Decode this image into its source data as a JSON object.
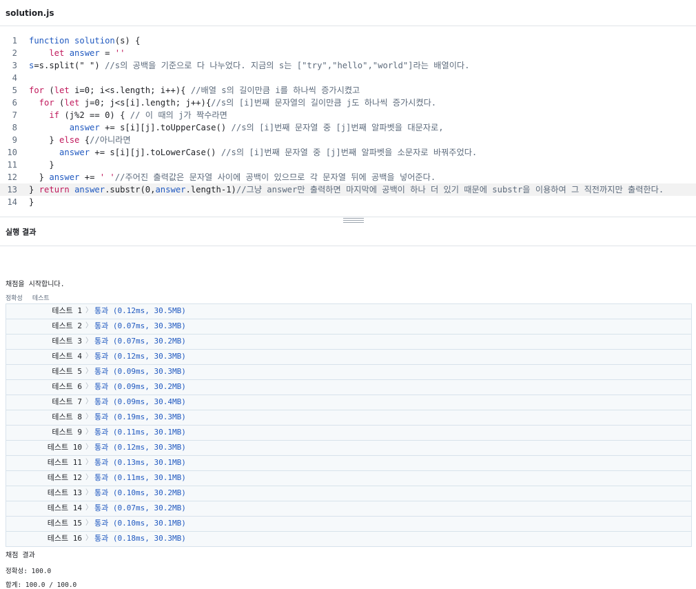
{
  "file": {
    "name": "solution.js"
  },
  "editor": {
    "lines": [
      {
        "num": "1",
        "tokens": [
          {
            "t": "function ",
            "c": "fn"
          },
          {
            "t": "solution",
            "c": "fn"
          },
          {
            "t": "(s) {",
            "c": ""
          }
        ]
      },
      {
        "num": "2",
        "tokens": [
          {
            "t": "    let ",
            "c": "kw"
          },
          {
            "t": "answer",
            "c": "fn"
          },
          {
            "t": " = ",
            "c": ""
          },
          {
            "t": "''",
            "c": "str"
          }
        ]
      },
      {
        "num": "3",
        "tokens": [
          {
            "t": "s",
            "c": "fn"
          },
          {
            "t": "=s.split(\" \") ",
            "c": ""
          },
          {
            "t": "//s의 공백을 기준으로 다 나누었다. 지금의 s는 [\"try\",\"hello\",\"world\"]라는 배열이다.",
            "c": "cm"
          }
        ]
      },
      {
        "num": "4",
        "tokens": []
      },
      {
        "num": "5",
        "tokens": [
          {
            "t": "for ",
            "c": "kw"
          },
          {
            "t": "(",
            "c": ""
          },
          {
            "t": "let ",
            "c": "kw"
          },
          {
            "t": "i=0; i<s.length; i++){ ",
            "c": ""
          },
          {
            "t": "//배열 s의 길이만큼 i를 하나씩 증가시켰고",
            "c": "cm"
          }
        ]
      },
      {
        "num": "6",
        "tokens": [
          {
            "t": "  for ",
            "c": "kw"
          },
          {
            "t": "(",
            "c": ""
          },
          {
            "t": "let ",
            "c": "kw"
          },
          {
            "t": "j=0; j<s[i].length; j++){",
            "c": ""
          },
          {
            "t": "//s의 [i]번째 문자열의 길이만큼 j도 하나씩 증가시켰다.",
            "c": "cm"
          }
        ]
      },
      {
        "num": "7",
        "tokens": [
          {
            "t": "    if ",
            "c": "kw"
          },
          {
            "t": "(j%2 == 0) { ",
            "c": ""
          },
          {
            "t": "// 이 때의 j가 짝수라면",
            "c": "cm"
          }
        ]
      },
      {
        "num": "8",
        "tokens": [
          {
            "t": "        ",
            "c": ""
          },
          {
            "t": "answer",
            "c": "fn"
          },
          {
            "t": " += s[i][j].toUpperCase() ",
            "c": ""
          },
          {
            "t": "//s의 [i]번째 문자열 중 [j]번째 알파벳을 대문자로,",
            "c": "cm"
          }
        ]
      },
      {
        "num": "9",
        "tokens": [
          {
            "t": "    } ",
            "c": ""
          },
          {
            "t": "else ",
            "c": "kw"
          },
          {
            "t": "{",
            "c": ""
          },
          {
            "t": "//아니라면",
            "c": "cm"
          }
        ]
      },
      {
        "num": "10",
        "tokens": [
          {
            "t": "      ",
            "c": ""
          },
          {
            "t": "answer",
            "c": "fn"
          },
          {
            "t": " += s[i][j].toLowerCase() ",
            "c": ""
          },
          {
            "t": "//s의 [i]번째 문자열 중 [j]번째 알파벳을 소문자로 바꿔주었다.",
            "c": "cm"
          }
        ]
      },
      {
        "num": "11",
        "tokens": [
          {
            "t": "    }",
            "c": ""
          }
        ]
      },
      {
        "num": "12",
        "tokens": [
          {
            "t": "  } ",
            "c": ""
          },
          {
            "t": "answer",
            "c": "fn"
          },
          {
            "t": " += ",
            "c": ""
          },
          {
            "t": "' '",
            "c": "str"
          },
          {
            "t": "//주어진 출력값은 문자열 사이에 공백이 있으므로 각 문자열 뒤에 공백을 넣어준다.",
            "c": "cm"
          }
        ]
      },
      {
        "num": "13",
        "tokens": [
          {
            "t": "} ",
            "c": ""
          },
          {
            "t": "return ",
            "c": "kw"
          },
          {
            "t": "answer",
            "c": "fn"
          },
          {
            "t": ".substr(0,",
            "c": ""
          },
          {
            "t": "answer",
            "c": "fn"
          },
          {
            "t": ".length-1)",
            "c": ""
          },
          {
            "t": "//그냥 answer만 출력하면 마지막에 공백이 하나 더 있기 때문에 substr을 이용하여 그 직전까지만 출력한다.",
            "c": "cm"
          }
        ]
      },
      {
        "num": "14",
        "tokens": [
          {
            "t": "}",
            "c": ""
          }
        ]
      }
    ],
    "active_line": 13
  },
  "result": {
    "title": "실행 결과",
    "start_message": "채점을 시작합니다.",
    "tabs": [
      "정확성",
      "테스트"
    ],
    "tests": [
      {
        "label": "테스트 1",
        "result": "통과 (0.12ms, 30.5MB)"
      },
      {
        "label": "테스트 2",
        "result": "통과 (0.07ms, 30.3MB)"
      },
      {
        "label": "테스트 3",
        "result": "통과 (0.07ms, 30.2MB)"
      },
      {
        "label": "테스트 4",
        "result": "통과 (0.12ms, 30.3MB)"
      },
      {
        "label": "테스트 5",
        "result": "통과 (0.09ms, 30.3MB)"
      },
      {
        "label": "테스트 6",
        "result": "통과 (0.09ms, 30.2MB)"
      },
      {
        "label": "테스트 7",
        "result": "통과 (0.09ms, 30.4MB)"
      },
      {
        "label": "테스트 8",
        "result": "통과 (0.19ms, 30.3MB)"
      },
      {
        "label": "테스트 9",
        "result": "통과 (0.11ms, 30.1MB)"
      },
      {
        "label": "테스트 10",
        "result": "통과 (0.12ms, 30.3MB)"
      },
      {
        "label": "테스트 11",
        "result": "통과 (0.13ms, 30.1MB)"
      },
      {
        "label": "테스트 12",
        "result": "통과 (0.11ms, 30.1MB)"
      },
      {
        "label": "테스트 13",
        "result": "통과 (0.10ms, 30.2MB)"
      },
      {
        "label": "테스트 14",
        "result": "통과 (0.07ms, 30.2MB)"
      },
      {
        "label": "테스트 15",
        "result": "통과 (0.10ms, 30.1MB)"
      },
      {
        "label": "테스트 16",
        "result": "통과 (0.18ms, 30.3MB)"
      }
    ],
    "score_title": "채점 결과",
    "accuracy": "정확성: 100.0",
    "total": "합계: 100.0 / 100.0"
  }
}
